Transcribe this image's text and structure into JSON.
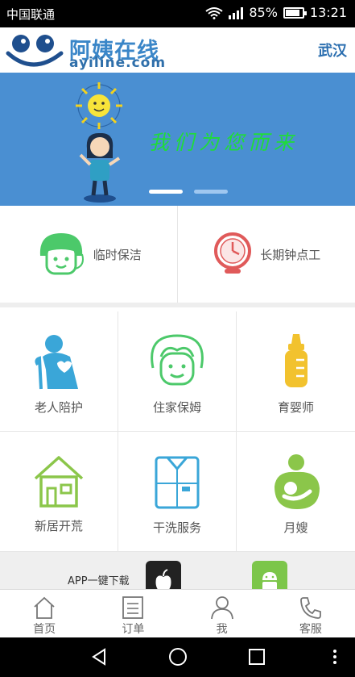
{
  "status_bar": {
    "carrier": "中国联通",
    "battery": "85%",
    "battery_level": 0.85,
    "time": "13:21",
    "icons": [
      "wifi-icon",
      "signal-icon",
      "battery-icon"
    ]
  },
  "header": {
    "logo_cn": "阿姨在线",
    "logo_en": "ayiline.com",
    "city": "武汉"
  },
  "banner": {
    "slogan": "我们为您而来",
    "active_slide": 1,
    "slide_count": 2
  },
  "quick_services": [
    {
      "label": "临时保洁",
      "icon": "cleaner-face-icon"
    },
    {
      "label": "长期钟点工",
      "icon": "clock-icon"
    }
  ],
  "services": [
    {
      "label": "老人陪护",
      "icon": "elderly-icon"
    },
    {
      "label": "住家保姆",
      "icon": "nanny-face-icon"
    },
    {
      "label": "育婴师",
      "icon": "baby-bottle-icon"
    },
    {
      "label": "新居开荒",
      "icon": "house-icon"
    },
    {
      "label": "干洗服务",
      "icon": "shirt-icon"
    },
    {
      "label": "月嫂",
      "icon": "mother-baby-icon"
    }
  ],
  "download": {
    "label": "APP一键下载",
    "icons": [
      "apple-icon",
      "android-icon"
    ]
  },
  "tabs": [
    {
      "label": "首页",
      "icon": "home-icon"
    },
    {
      "label": "订单",
      "icon": "order-icon"
    },
    {
      "label": "我",
      "icon": "user-icon"
    },
    {
      "label": "客服",
      "icon": "phone-icon"
    }
  ],
  "colors": {
    "brand_blue": "#3a86c8",
    "banner_bg": "#4a8fd2",
    "slogan_green": "#1fdc3a",
    "green": "#4cc96a",
    "red": "#e05a5a",
    "cyan": "#3aa6d8",
    "yellow": "#f2c22e",
    "lime": "#8bc64a"
  }
}
